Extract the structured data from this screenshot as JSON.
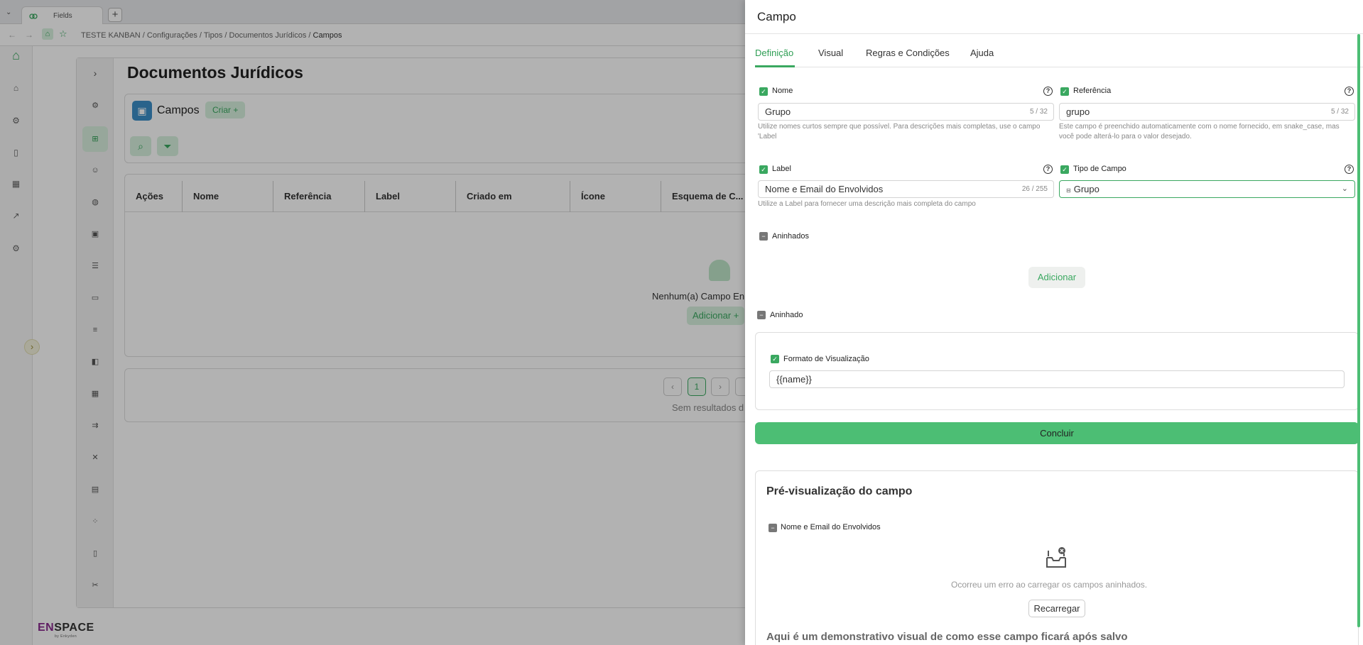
{
  "browser": {
    "tab_title": "Fields",
    "breadcrumb": [
      "TESTE KANBAN",
      "Configurações",
      "Tipos",
      "Documentos Jurídicos",
      "Campos"
    ]
  },
  "page": {
    "title": "Documentos Jurídicos",
    "section_label": "Campos",
    "create_label": "Criar +",
    "table_headers": [
      "Ações",
      "Nome",
      "Referência",
      "Label",
      "Criado em",
      "Ícone",
      "Esquema de C..."
    ],
    "empty_text": "Nenhum(a) Campo En",
    "empty_add": "Adicionar +",
    "current_page": "1",
    "no_results": "Sem resultados d"
  },
  "logo": {
    "brand_a": "EN",
    "brand_b": "SPACE",
    "sub": "by Enkyden"
  },
  "panel": {
    "title": "Campo",
    "tabs": [
      "Definição",
      "Visual",
      "Regras e Condições",
      "Ajuda"
    ],
    "active_tab": 0,
    "fields": {
      "nome": {
        "label": "Nome",
        "value": "Grupo",
        "count": "5 / 32",
        "hint": "Utilize nomes curtos sempre que possível. Para descrições mais completas, use o campo 'Label"
      },
      "referencia": {
        "label": "Referência",
        "value": "grupo",
        "count": "5 / 32",
        "hint": "Este campo é preenchido automaticamente com o nome fornecido, em snake_case, mas você pode alterá-lo para o valor desejado."
      },
      "label": {
        "label": "Label",
        "value": "Nome e Email do Envolvidos",
        "count": "26 / 255",
        "hint": "Utilize a Label para fornecer uma descrição mais completa do campo"
      },
      "tipo": {
        "label": "Tipo de Campo",
        "value": "Grupo"
      }
    },
    "aninhados_label": "Aninhados",
    "adicionar_label": "Adicionar",
    "aninhado_label": "Aninhado",
    "formato_label": "Formato de Visualização",
    "formato_value": "{{name}}",
    "concluir_label": "Concluir",
    "preview": {
      "title": "Pré-visualização do campo",
      "group_label": "Nome e Email do Envolvidos",
      "error_text": "Ocorreu um erro ao carregar os campos aninhados.",
      "reload_label": "Recarregar",
      "demo_text": "Aqui é um demonstrativo visual de como esse campo ficará após salvo"
    }
  },
  "colors": {
    "accent": "#3aa860",
    "accent_light": "#d7f1de",
    "button": "#4cbe74"
  }
}
